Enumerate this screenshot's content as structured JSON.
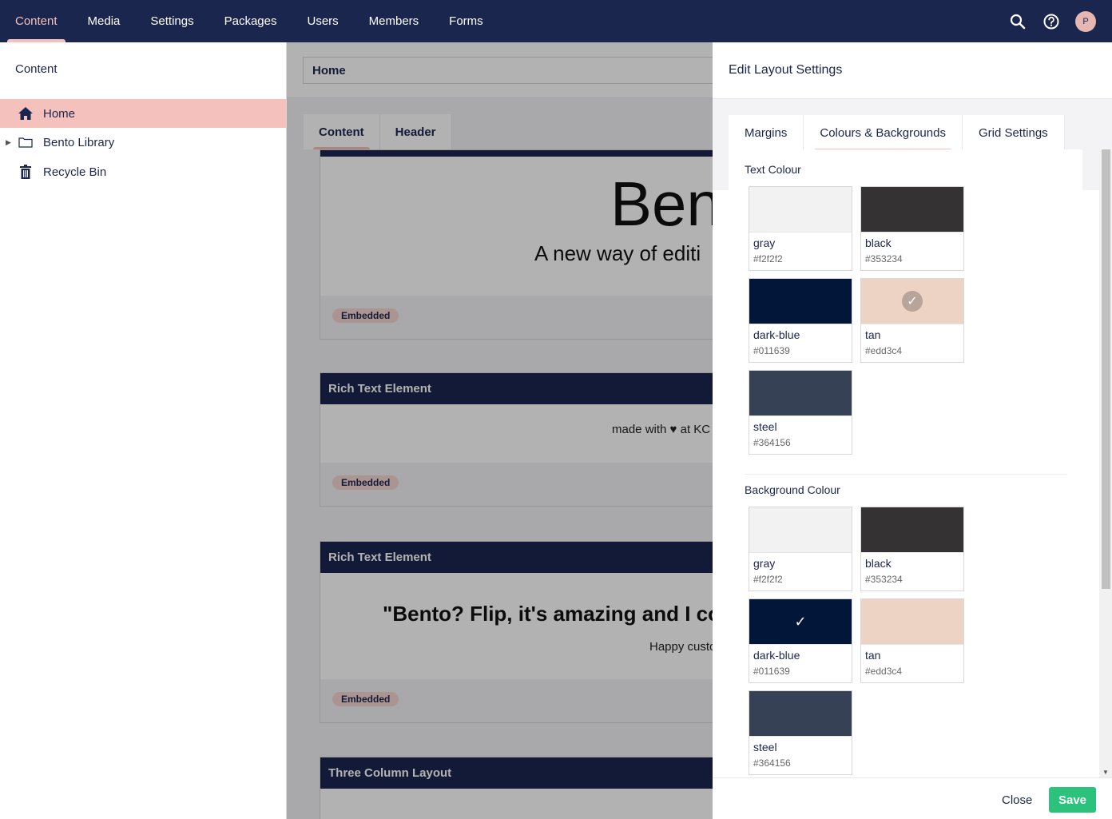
{
  "nav": {
    "items": [
      {
        "label": "Content",
        "active": true
      },
      {
        "label": "Media"
      },
      {
        "label": "Settings"
      },
      {
        "label": "Packages"
      },
      {
        "label": "Users"
      },
      {
        "label": "Members"
      },
      {
        "label": "Forms"
      }
    ],
    "avatar_initial": "P",
    "icons": [
      "search-icon",
      "help-icon"
    ]
  },
  "tree": {
    "title": "Content",
    "items": [
      {
        "label": "Home",
        "icon": "home-icon",
        "active": true
      },
      {
        "label": "Bento Library",
        "icon": "folder-icon",
        "expandable": true
      },
      {
        "label": "Recycle Bin",
        "icon": "trash-icon"
      }
    ]
  },
  "editor": {
    "name_value": "Home",
    "tabs": [
      "Content",
      "Header"
    ],
    "blocks": [
      {
        "heading": "",
        "big_text": "Ben",
        "subtitle": "A new way of editi",
        "badge": "Embedded"
      },
      {
        "heading": "Rich Text Element",
        "text_before": "made with",
        "text_after": "at KC",
        "badge": "Embedded"
      },
      {
        "heading": "Rich Text Element",
        "quote": "\"Bento? Flip, it's amazing and I cou",
        "caption": "Happy custo",
        "badge": "Embedded"
      },
      {
        "heading": "Three Column Layout"
      }
    ]
  },
  "panel": {
    "title": "Edit Layout Settings",
    "tabs": [
      "Margins",
      "Colours & Backgrounds",
      "Grid Settings"
    ],
    "active_tab": "Colours & Backgrounds",
    "text_colour": {
      "label": "Text Colour",
      "selected": "tan",
      "swatches": [
        {
          "name": "gray",
          "hex": "#f2f2f2"
        },
        {
          "name": "black",
          "hex": "#353234"
        },
        {
          "name": "dark-blue",
          "hex": "#011639"
        },
        {
          "name": "tan",
          "hex": "#edd3c4"
        },
        {
          "name": "steel",
          "hex": "#364156"
        }
      ]
    },
    "background_colour": {
      "label": "Background Colour",
      "selected": "dark-blue",
      "swatches": [
        {
          "name": "gray",
          "hex": "#f2f2f2"
        },
        {
          "name": "black",
          "hex": "#353234"
        },
        {
          "name": "dark-blue",
          "hex": "#011639"
        },
        {
          "name": "tan",
          "hex": "#edd3c4"
        },
        {
          "name": "steel",
          "hex": "#364156"
        }
      ]
    },
    "close_label": "Close",
    "save_label": "Save"
  },
  "colors": {
    "nav_bg": "#1b264f",
    "accent": "#f5c1bc",
    "save": "#2bc37c"
  }
}
